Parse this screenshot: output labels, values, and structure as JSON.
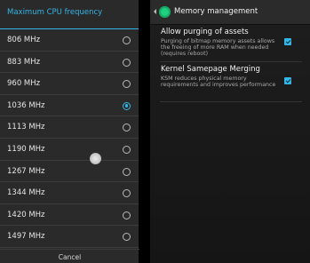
{
  "dialog": {
    "title": "Maximum CPU frequency",
    "options": [
      {
        "label": "806 MHz",
        "selected": false
      },
      {
        "label": "883 MHz",
        "selected": false
      },
      {
        "label": "960 MHz",
        "selected": false
      },
      {
        "label": "1036 MHz",
        "selected": true
      },
      {
        "label": "1113 MHz",
        "selected": false
      },
      {
        "label": "1190 MHz",
        "selected": false
      },
      {
        "label": "1267 MHz",
        "selected": false
      },
      {
        "label": "1344 MHz",
        "selected": false
      },
      {
        "label": "1420 MHz",
        "selected": false
      },
      {
        "label": "1497 MHz",
        "selected": false
      }
    ],
    "cancel_label": "Cancel"
  },
  "settings": {
    "title": "Memory management",
    "items": [
      {
        "title": "Allow purging of assets",
        "summary": "Purging of bitmap memory assets allows the freeing of more RAM when needed (requires reboot)",
        "checked": true
      },
      {
        "title": "Kernel Samepage Merging",
        "summary": "KSM reduces physical memory requirements and improves performance",
        "checked": true
      }
    ]
  },
  "colors": {
    "accent": "#33b5e5",
    "dialog_bg": "#2a2a2a",
    "app_icon": "#1ecf7f"
  }
}
